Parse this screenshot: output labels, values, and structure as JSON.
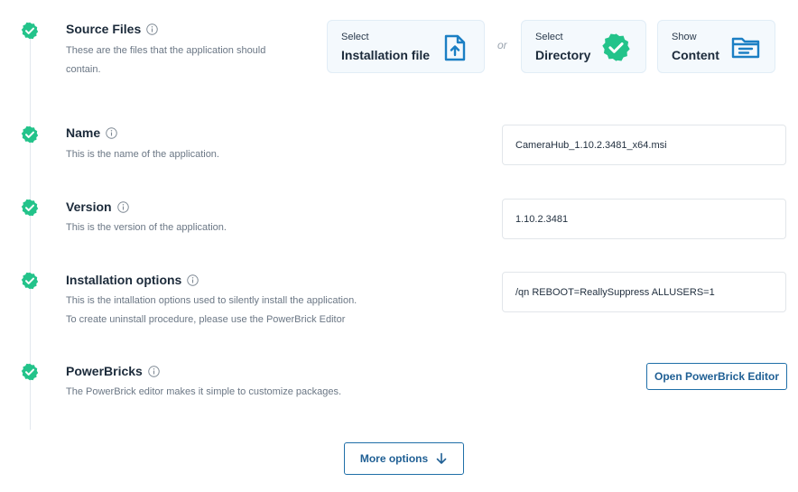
{
  "colors": {
    "check": "#23c38a",
    "accent": "#1b7fc4",
    "button_border": "#1f6fa8"
  },
  "steps": {
    "source_files": {
      "title": "Source Files",
      "desc_line1": "These are the files that the application should",
      "desc_line2": "contain.",
      "or_label": "or",
      "cards": [
        {
          "small": "Select",
          "big": "Installation file",
          "icon": "file-upload-icon"
        },
        {
          "small": "Select",
          "big": "Directory",
          "icon": "verified-check-badge-icon"
        },
        {
          "small": "Show",
          "big": "Content",
          "icon": "folder-icon"
        }
      ]
    },
    "name": {
      "title": "Name",
      "desc": "This is the name of the application.",
      "value": "CameraHub_1.10.2.3481_x64.msi"
    },
    "version": {
      "title": "Version",
      "desc": "This is the version of the application.",
      "value": "1.10.2.3481"
    },
    "install_options": {
      "title": "Installation options",
      "desc_line1": "This is the intallation options used to silently install the application.",
      "desc_line2": "To create uninstall procedure, please use the PowerBrick Editor",
      "value": "/qn REBOOT=ReallySuppress ALLUSERS=1"
    },
    "powerbricks": {
      "title": "PowerBricks",
      "desc": "The PowerBrick editor makes it simple to customize packages.",
      "button_label": "Open PowerBrick Editor"
    }
  },
  "more_options": {
    "label": "More options",
    "icon": "arrow-down-icon"
  }
}
